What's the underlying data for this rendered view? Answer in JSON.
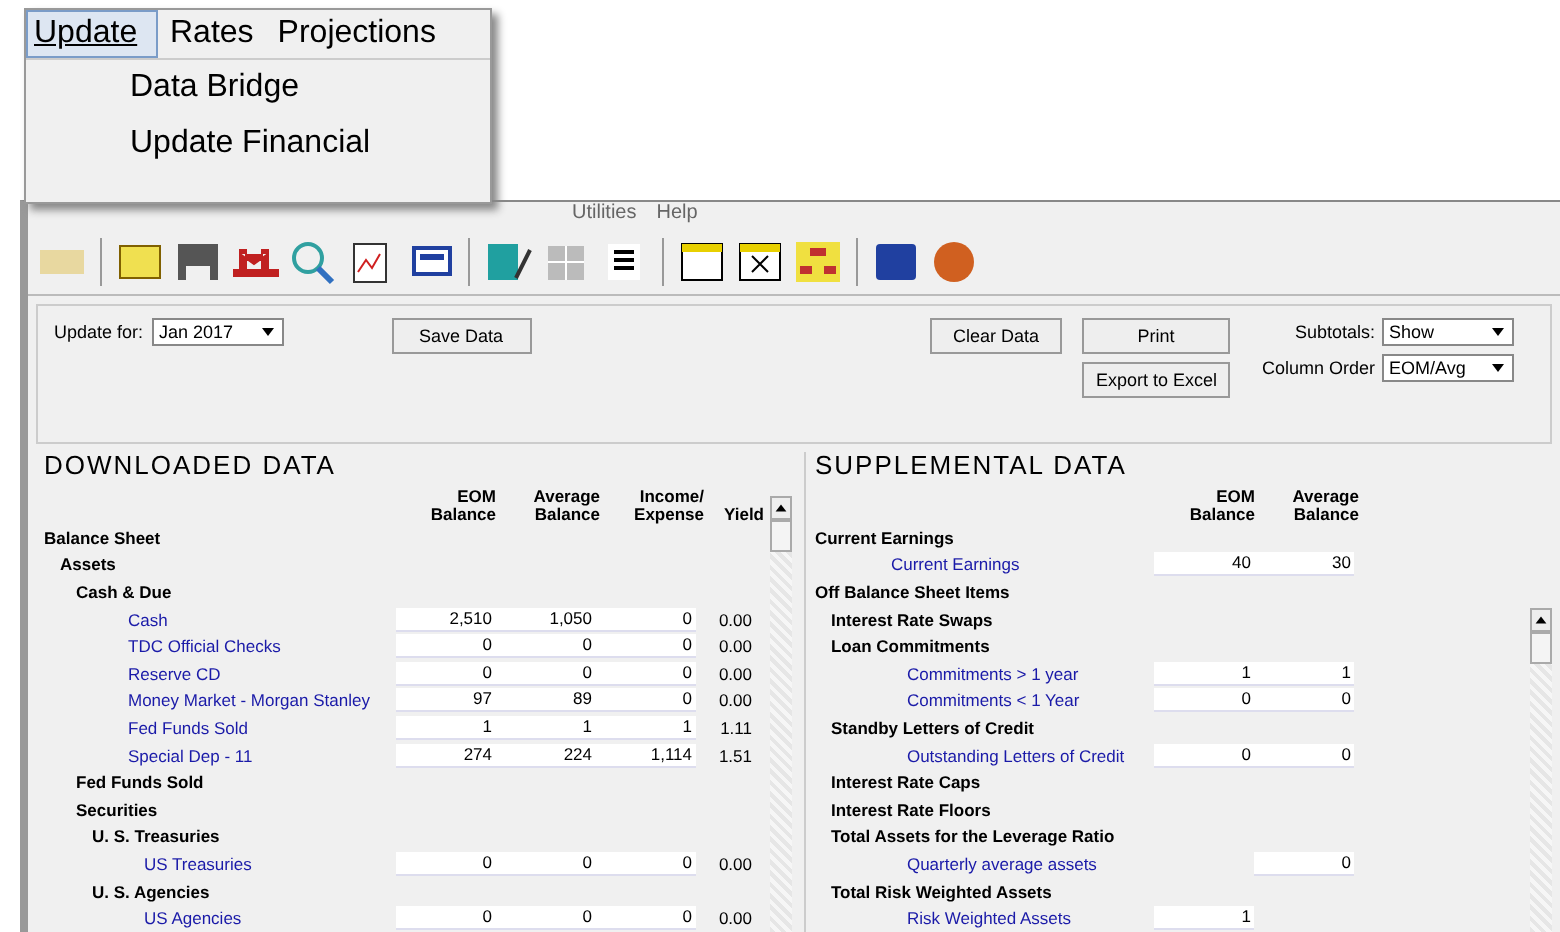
{
  "popup_menu": {
    "menus": [
      {
        "label": "Update",
        "selected": true
      },
      {
        "label": "Rates",
        "selected": false
      },
      {
        "label": "Projections",
        "selected": false
      }
    ],
    "items": [
      "Data Bridge",
      "Update Financial"
    ]
  },
  "menu_bar": [
    "Utilities",
    "Help"
  ],
  "form": {
    "update_for_label": "Update for:",
    "update_for_value": "Jan 2017",
    "save_button": "Save Data",
    "clear_button": "Clear Data",
    "print_button": "Print",
    "export_button": "Export to Excel",
    "subtotals_label": "Subtotals:",
    "subtotals_value": "Show",
    "column_order_label": "Column Order",
    "column_order_value": "EOM/Avg"
  },
  "downloaded": {
    "title": "DOWNLOADED DATA",
    "columns": [
      "EOM Balance",
      "Average Balance",
      "Income/ Expense",
      "Yield"
    ],
    "rows": [
      {
        "kind": "group",
        "label": "Balance Sheet",
        "children": [
          {
            "kind": "group",
            "label": "Assets",
            "children": [
              {
                "kind": "group",
                "label": "Cash & Due",
                "children": [
                  {
                    "kind": "item",
                    "label": "Cash",
                    "values": [
                      "2,510",
                      "1,050",
                      "0",
                      "0.00"
                    ]
                  },
                  {
                    "kind": "item",
                    "label": "TDC Official Checks",
                    "values": [
                      "0",
                      "0",
                      "0",
                      "0.00"
                    ]
                  },
                  {
                    "kind": "item",
                    "label": "Reserve CD",
                    "values": [
                      "0",
                      "0",
                      "0",
                      "0.00"
                    ]
                  },
                  {
                    "kind": "item",
                    "label": "Money Market - Morgan Stanley",
                    "values": [
                      "97",
                      "89",
                      "0",
                      "0.00"
                    ]
                  },
                  {
                    "kind": "item",
                    "label": "Fed Funds Sold",
                    "values": [
                      "1",
                      "1",
                      "1",
                      "1.11"
                    ]
                  },
                  {
                    "kind": "item",
                    "label": "Special Dep - 11",
                    "values": [
                      "274",
                      "224",
                      "1,114",
                      "1.51"
                    ]
                  }
                ]
              },
              {
                "kind": "group",
                "label": "Fed Funds Sold"
              },
              {
                "kind": "group",
                "label": "Securities",
                "children": [
                  {
                    "kind": "group",
                    "label": "U. S. Treasuries",
                    "children": [
                      {
                        "kind": "item",
                        "label": "US Treasuries",
                        "values": [
                          "0",
                          "0",
                          "0",
                          "0.00"
                        ]
                      }
                    ]
                  },
                  {
                    "kind": "group",
                    "label": "U. S. Agencies",
                    "children": [
                      {
                        "kind": "item",
                        "label": "US Agencies",
                        "values": [
                          "0",
                          "0",
                          "0",
                          "0.00"
                        ]
                      }
                    ]
                  }
                ]
              }
            ]
          }
        ]
      }
    ]
  },
  "supplemental": {
    "title": "SUPPLEMENTAL DATA",
    "columns": [
      "EOM Balance",
      "Average Balance"
    ],
    "rows": [
      {
        "kind": "group",
        "label": "Current Earnings",
        "children": [
          {
            "kind": "item",
            "label": "Current Earnings",
            "eom": "40",
            "avg": "30"
          }
        ]
      },
      {
        "kind": "group",
        "label": "Off Balance Sheet Items",
        "children": [
          {
            "kind": "group",
            "label": "Interest Rate Swaps"
          },
          {
            "kind": "group",
            "label": "Loan Commitments",
            "children": [
              {
                "kind": "item",
                "label": "Commitments > 1 year",
                "eom": "1",
                "avg": "1"
              },
              {
                "kind": "item",
                "label": "Commitments < 1 Year",
                "eom": "0",
                "avg": "0"
              }
            ]
          },
          {
            "kind": "group",
            "label": "Standby Letters of Credit",
            "children": [
              {
                "kind": "item",
                "label": "Outstanding Letters of Credit",
                "eom": "0",
                "avg": "0"
              }
            ]
          },
          {
            "kind": "group",
            "label": "Interest Rate Caps"
          },
          {
            "kind": "group",
            "label": "Interest Rate Floors"
          },
          {
            "kind": "group",
            "label": "Total Assets for the Leverage Ratio",
            "children": [
              {
                "kind": "item",
                "label": "Quarterly average assets",
                "avg": "0"
              }
            ]
          },
          {
            "kind": "group",
            "label": "Total Risk Weighted Assets",
            "children": [
              {
                "kind": "item",
                "label": "Risk Weighted Assets",
                "eom": "1"
              }
            ]
          }
        ]
      }
    ]
  }
}
